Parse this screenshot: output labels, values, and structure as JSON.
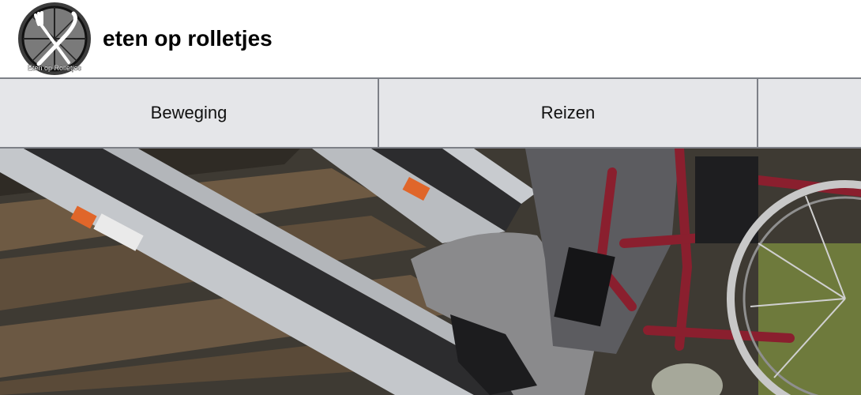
{
  "header": {
    "logo_text": "Eten op Rolletjes",
    "site_title": "eten op rolletjes"
  },
  "nav": {
    "items": [
      {
        "label": "Beweging"
      },
      {
        "label": "Reizen"
      },
      {
        "label": ""
      }
    ]
  },
  "hero": {
    "image_label": "wheelchair-ramp-photo"
  },
  "colors": {
    "nav_background": "#e5e6e9",
    "nav_border": "#7d8087",
    "ramp_aluminium": "#b9bcc0",
    "ramp_grip": "#2c2c2e",
    "wheelchair_frame": "#8a1f2e",
    "wood_plank": "#6e5a43"
  }
}
